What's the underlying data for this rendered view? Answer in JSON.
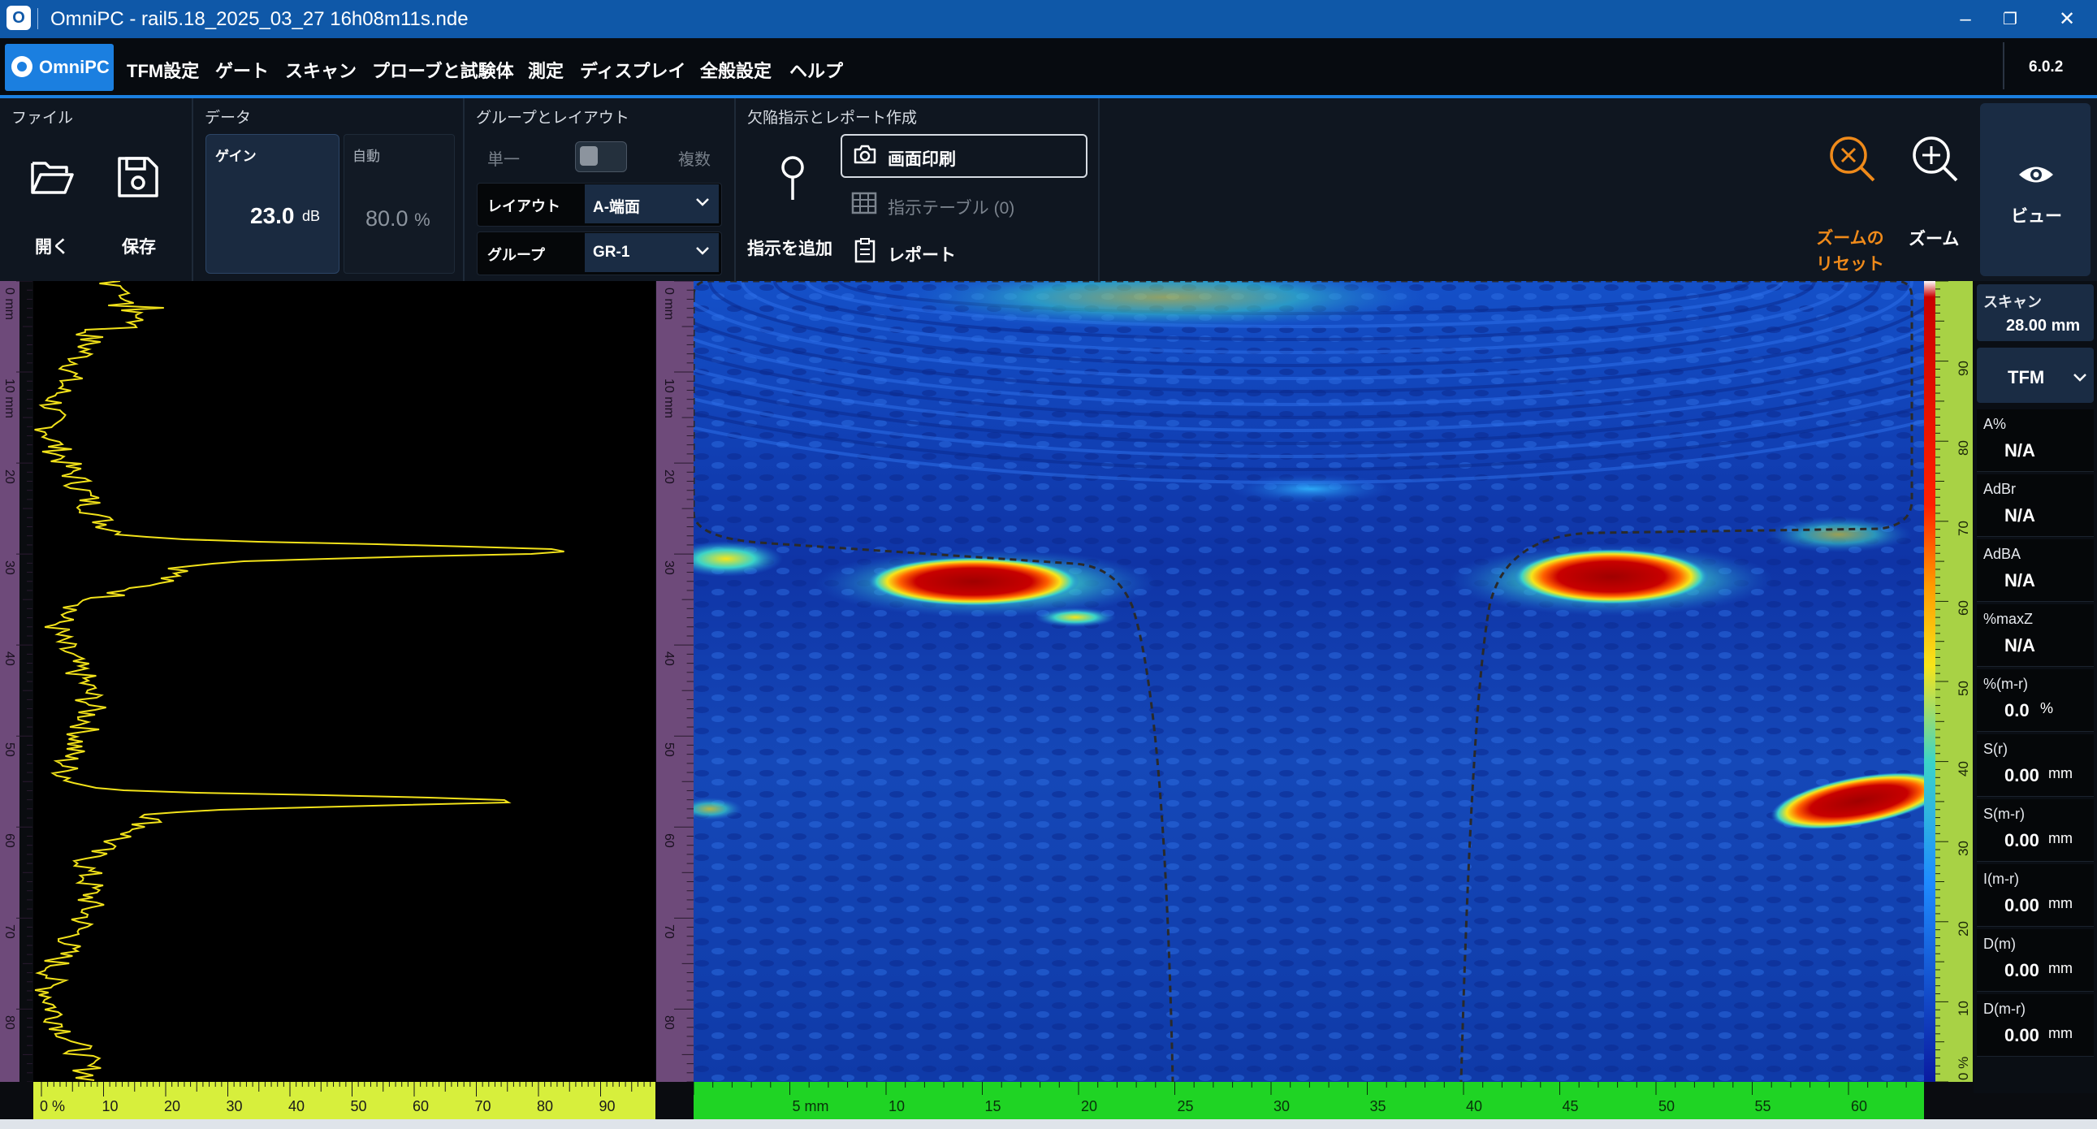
{
  "window": {
    "title": "OmniPC - rail5.18_2025_03_27 16h08m11s.nde",
    "minimize": "–",
    "restore": "❐",
    "close": "✕"
  },
  "menu": {
    "brand": "OmniPC",
    "items": [
      "TFM設定",
      "ゲート",
      "スキャン",
      "プローブと試験体",
      "測定",
      "ディスプレイ",
      "全般設定",
      "ヘルプ"
    ],
    "version": "6.0.2"
  },
  "toolbar": {
    "file": {
      "section": "ファイル",
      "open": "開く",
      "save": "保存"
    },
    "data": {
      "section": "データ",
      "gain_label": "ゲイン",
      "gain_value": "23.0",
      "gain_unit": "dB",
      "auto_label": "自動",
      "auto_value": "80.0",
      "auto_unit": "%"
    },
    "group": {
      "section": "グループとレイアウト",
      "single": "単一",
      "multiple": "複数",
      "layout_label": "レイアウト",
      "layout_value": "A-端面",
      "group_label": "グループ",
      "group_value": "GR-1"
    },
    "indication": {
      "section": "欠陥指示とレポート作成",
      "add": "指示を追加",
      "print": "画面印刷",
      "table": "指示テーブル (0)",
      "report": "レポート"
    },
    "zoom_reset": "ズームのリセット",
    "zoom": "ズーム",
    "view": "ビュー"
  },
  "ascan": {
    "left_ruler_ticks": [
      "0 mm",
      "10 mm",
      "20",
      "30",
      "40",
      "50",
      "60",
      "70",
      "80"
    ],
    "bottom_ticks": [
      "0 %",
      "10",
      "20",
      "30",
      "40",
      "50",
      "60",
      "70",
      "80",
      "90"
    ]
  },
  "tfm_view": {
    "left_ruler_ticks": [
      "0 mm",
      "10 mm",
      "20",
      "30",
      "40",
      "50",
      "60",
      "70",
      "80"
    ],
    "bottom_ticks": [
      "5 mm",
      "10",
      "15",
      "20",
      "25",
      "30",
      "35",
      "40",
      "45",
      "50",
      "55",
      "60"
    ],
    "depth_ticks": [
      "90",
      "80",
      "70",
      "60",
      "50",
      "40",
      "30",
      "20",
      "10",
      "0 %"
    ]
  },
  "readings": {
    "scan_label": "スキャン",
    "scan_value": "28.00 mm",
    "mode": "TFM",
    "items": [
      {
        "label": "A%",
        "value": "N/A",
        "unit": ""
      },
      {
        "label": "AdBr",
        "value": "N/A",
        "unit": ""
      },
      {
        "label": "AdBA",
        "value": "N/A",
        "unit": ""
      },
      {
        "label": "%maxZ",
        "value": "N/A",
        "unit": ""
      },
      {
        "label": "%(m-r)",
        "value": "0.0",
        "unit": "%"
      },
      {
        "label": "S(r)",
        "value": "0.00",
        "unit": "mm"
      },
      {
        "label": "S(m-r)",
        "value": "0.00",
        "unit": "mm"
      },
      {
        "label": "I(m-r)",
        "value": "0.00",
        "unit": "mm"
      },
      {
        "label": "D(m)",
        "value": "0.00",
        "unit": "mm"
      },
      {
        "label": "D(m-r)",
        "value": "0.00",
        "unit": "mm"
      }
    ]
  },
  "colors": {
    "accent": "#1b7fe0",
    "zoom_reset": "#ef8a1a",
    "ascan_trace": "#f2e21a",
    "scan_ruler": "#1fd424",
    "amp_ruler": "#d7ef3c"
  }
}
